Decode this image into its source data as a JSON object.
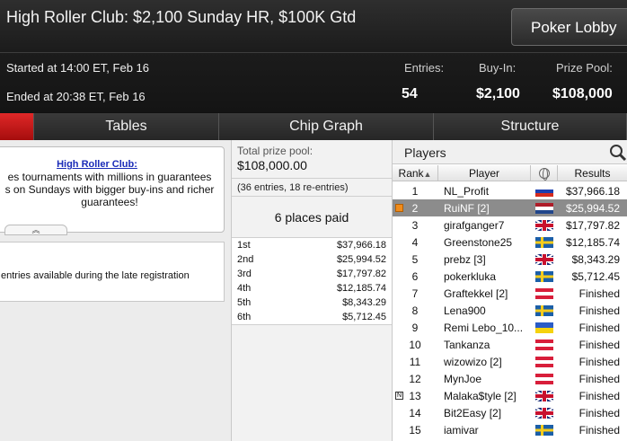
{
  "header": {
    "title": "High Roller Club: $2,100 Sunday HR, $100K Gtd",
    "lobby_button": "Poker Lobby",
    "started": "Started at 14:00 ET, Feb 16",
    "ended": "Ended at 20:38 ET, Feb 16",
    "stats": {
      "entries_label": "Entries:",
      "entries_value": "54",
      "buyin_label": "Buy-In:",
      "buyin_value": "$2,100",
      "prizepool_label": "Prize Pool:",
      "prizepool_value": "$108,000"
    }
  },
  "tabs": [
    {
      "label": "",
      "active": true
    },
    {
      "label": "Tables"
    },
    {
      "label": "Chip Graph"
    },
    {
      "label": "Structure"
    }
  ],
  "info": {
    "title": "High Roller Club:",
    "lines": [
      "es tournaments with millions in guarantees",
      "s on Sundays with bigger buy-ins and richer",
      "guarantees!"
    ],
    "late_reg": "entries available during the late registration"
  },
  "prize": {
    "total_label": "Total prize pool:",
    "total_value": "$108,000.00",
    "entries_note": "(36 entries, 18 re-entries)",
    "places_paid": "6 places paid",
    "payouts": [
      {
        "place": "1st",
        "amount": "$37,966.18"
      },
      {
        "place": "2nd",
        "amount": "$25,994.52"
      },
      {
        "place": "3rd",
        "amount": "$17,797.82"
      },
      {
        "place": "4th",
        "amount": "$12,185.74"
      },
      {
        "place": "5th",
        "amount": "$8,343.29"
      },
      {
        "place": "6th",
        "amount": "$5,712.45"
      }
    ]
  },
  "players": {
    "title": "Players",
    "columns": {
      "rank": "Rank",
      "player": "Player",
      "results": "Results"
    },
    "rows": [
      {
        "rank": "1",
        "name": "NL_Profit",
        "flag": "ru",
        "result": "$37,966.18"
      },
      {
        "rank": "2",
        "name": "RuiNF [2]",
        "flag": "nl",
        "result": "$25,994.52",
        "selected": true,
        "marker": "orange"
      },
      {
        "rank": "3",
        "name": "girafganger7",
        "flag": "gb",
        "result": "$17,797.82"
      },
      {
        "rank": "4",
        "name": "Greenstone25",
        "flag": "se",
        "result": "$12,185.74"
      },
      {
        "rank": "5",
        "name": "prebz [3]",
        "flag": "gb",
        "result": "$8,343.29"
      },
      {
        "rank": "6",
        "name": "pokerkluka",
        "flag": "se",
        "result": "$5,712.45"
      },
      {
        "rank": "7",
        "name": "Graftekkel [2]",
        "flag": "at",
        "result": "Finished"
      },
      {
        "rank": "8",
        "name": "Lena900",
        "flag": "se",
        "result": "Finished"
      },
      {
        "rank": "9",
        "name": "Remi Lebo_10...",
        "flag": "ua",
        "result": "Finished"
      },
      {
        "rank": "10",
        "name": "Tankanza",
        "flag": "at",
        "result": "Finished"
      },
      {
        "rank": "11",
        "name": "wizowizo [2]",
        "flag": "at",
        "result": "Finished"
      },
      {
        "rank": "12",
        "name": "MynJoe",
        "flag": "at",
        "result": "Finished"
      },
      {
        "rank": "13",
        "name": "Malaka$tyle [2]",
        "flag": "gb",
        "result": "Finished",
        "marker": "note"
      },
      {
        "rank": "14",
        "name": "Bit2Easy [2]",
        "flag": "gb",
        "result": "Finished"
      },
      {
        "rank": "15",
        "name": "iamivar",
        "flag": "se",
        "result": "Finished"
      }
    ]
  },
  "icons": {
    "search": "search-icon",
    "globe": "globe-icon",
    "sort": "sort-arrow-icon",
    "expand": "chevron-up-icon"
  },
  "colors": {
    "accent_tab": "#c41818",
    "selected_row": "#8c8c8c",
    "link": "#1a2bb8",
    "marker": "#f08c1c"
  }
}
